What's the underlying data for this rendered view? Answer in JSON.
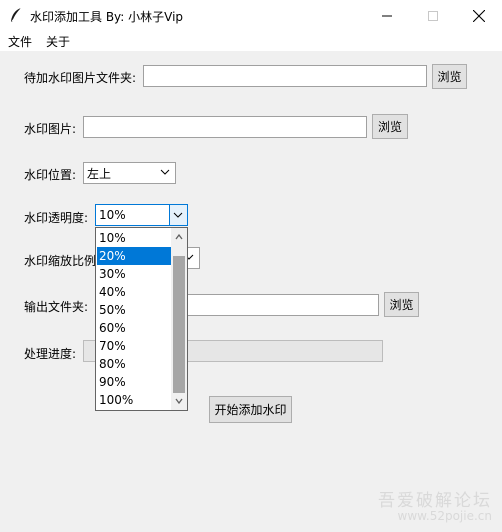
{
  "window": {
    "title": "水印添加工具 By: 小林子Vip",
    "minimize_icon": "minimize-icon",
    "maximize_icon": "maximize-icon",
    "close_icon": "close-icon"
  },
  "menu": {
    "items": [
      {
        "label": "文件"
      },
      {
        "label": "关于"
      }
    ]
  },
  "form": {
    "source_folder": {
      "label": "待加水印图片文件夹:",
      "value": "",
      "browse_label": "浏览"
    },
    "watermark_image": {
      "label": "水印图片:",
      "value": "",
      "browse_label": "浏览"
    },
    "position": {
      "label": "水印位置:",
      "value": "左上"
    },
    "opacity": {
      "label": "水印透明度:",
      "value": "10%",
      "options": [
        "10%",
        "20%",
        "30%",
        "40%",
        "50%",
        "60%",
        "70%",
        "80%",
        "90%",
        "100%"
      ],
      "highlighted": "20%"
    },
    "scale": {
      "label": "水印缩放比例:"
    },
    "output_folder": {
      "label": "输出文件夹:",
      "value": "",
      "browse_label": "浏览"
    },
    "progress": {
      "label": "处理进度:",
      "value": 0
    },
    "start_button": "开始添加水印"
  },
  "watermark": {
    "logo_text": "吾爱破解论坛",
    "url_text": "www.52pojie.cn"
  },
  "colors": {
    "selection": "#0078d7",
    "titlebar": "#ffffff",
    "background": "#f0f0f0"
  }
}
